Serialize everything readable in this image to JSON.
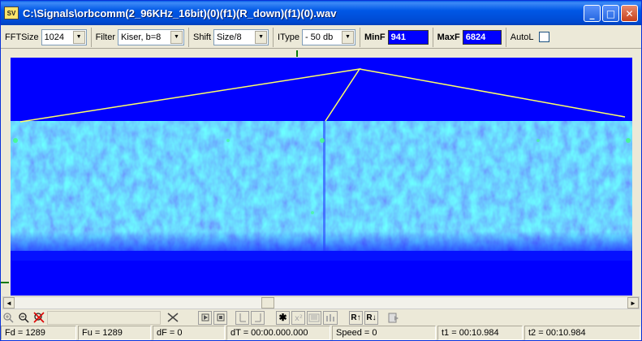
{
  "window": {
    "app_icon": "SV",
    "title": "C:\\Signals\\orbcomm(2_96KHz_16bit)(0)(f1)(R_down)(f1)(0).wav",
    "buttons": {
      "minimize": "_",
      "maximize": "□",
      "close": "✕"
    }
  },
  "toolbar": {
    "fftsize": {
      "label": "FFTSize",
      "value": "1024"
    },
    "filter": {
      "label": "Filter",
      "value": "Kiser, b=8"
    },
    "shift": {
      "label": "Shift",
      "value": "Size/8"
    },
    "itype": {
      "label": "IType",
      "value": "- 50 db"
    },
    "minf": {
      "label": "MinF",
      "value": "941"
    },
    "maxf": {
      "label": "MaxF",
      "value": "6824"
    },
    "autol": {
      "label": "AutoL",
      "checked": false
    }
  },
  "bottom_tools": {
    "icons": [
      "zoom-in-icon",
      "zoom-out-icon",
      "no-zoom-icon",
      "crossed-tools-icon",
      "play-icon",
      "stop-icon",
      "cursor-left-icon",
      "cursor-right-icon",
      "asterisk-icon",
      "sigma-icon",
      "waterfall-icon",
      "bars-icon",
      "sort-up-icon",
      "sort-down-icon",
      "export-icon"
    ],
    "r_up_label": "R↑",
    "r_down_label": "R↓",
    "asterisk_label": "✱"
  },
  "status": {
    "fd": "Fd = 1289",
    "fu": "Fu = 1289",
    "df": "dF = 0",
    "dt": "dT = 00:00.000.000",
    "speed": "Speed = 0",
    "t1": "t1 = 00:10.984",
    "t2": "t2 = 00:10.984"
  },
  "colors": {
    "spectrogram_bg": "#0000ff",
    "signal_band": "#1e6bff",
    "marker_line": "#ffff66",
    "minmax_box": "#0000ff"
  }
}
